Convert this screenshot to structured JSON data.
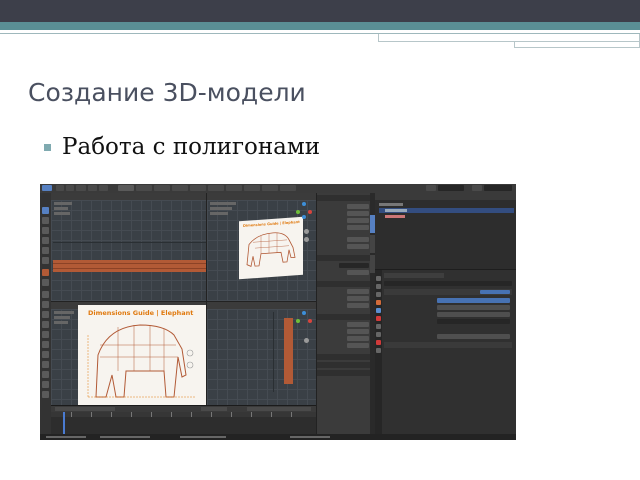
{
  "slide": {
    "title": "Создание 3D-модели",
    "bullets": [
      "Работа с полигонами"
    ],
    "accent_color": "#5a8f95",
    "header_color": "#3d3f4a",
    "bullet_color": "#7faab0"
  },
  "app": {
    "reference_title": "Dimensions Guide | Elephant",
    "accent_color": "#5680c2",
    "strip_color": "#b25a36",
    "reference_line_color": "#e07a10"
  }
}
